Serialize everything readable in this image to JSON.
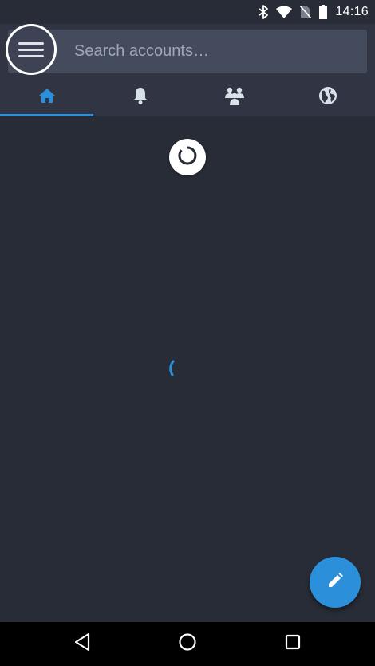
{
  "status_bar": {
    "time": "14:16",
    "icons": [
      "bluetooth-icon",
      "wifi-icon",
      "no-sim-icon",
      "battery-icon"
    ]
  },
  "search": {
    "placeholder": "Search accounts…"
  },
  "tabs": [
    {
      "name": "home",
      "icon": "home-icon",
      "active": true
    },
    {
      "name": "notifications",
      "icon": "bell-icon",
      "active": false
    },
    {
      "name": "local",
      "icon": "users-icon",
      "active": false
    },
    {
      "name": "federated",
      "icon": "globe-icon",
      "active": false
    }
  ],
  "colors": {
    "background": "#282c37",
    "top_bar": "#313543",
    "search_box": "#444b5d",
    "accent": "#2b90d9",
    "inactive_icon": "#d9e1e8"
  },
  "fab": {
    "icon": "pencil-icon"
  },
  "nav_bar": {
    "icons": [
      "back-icon",
      "home-circle-icon",
      "recents-icon"
    ]
  }
}
